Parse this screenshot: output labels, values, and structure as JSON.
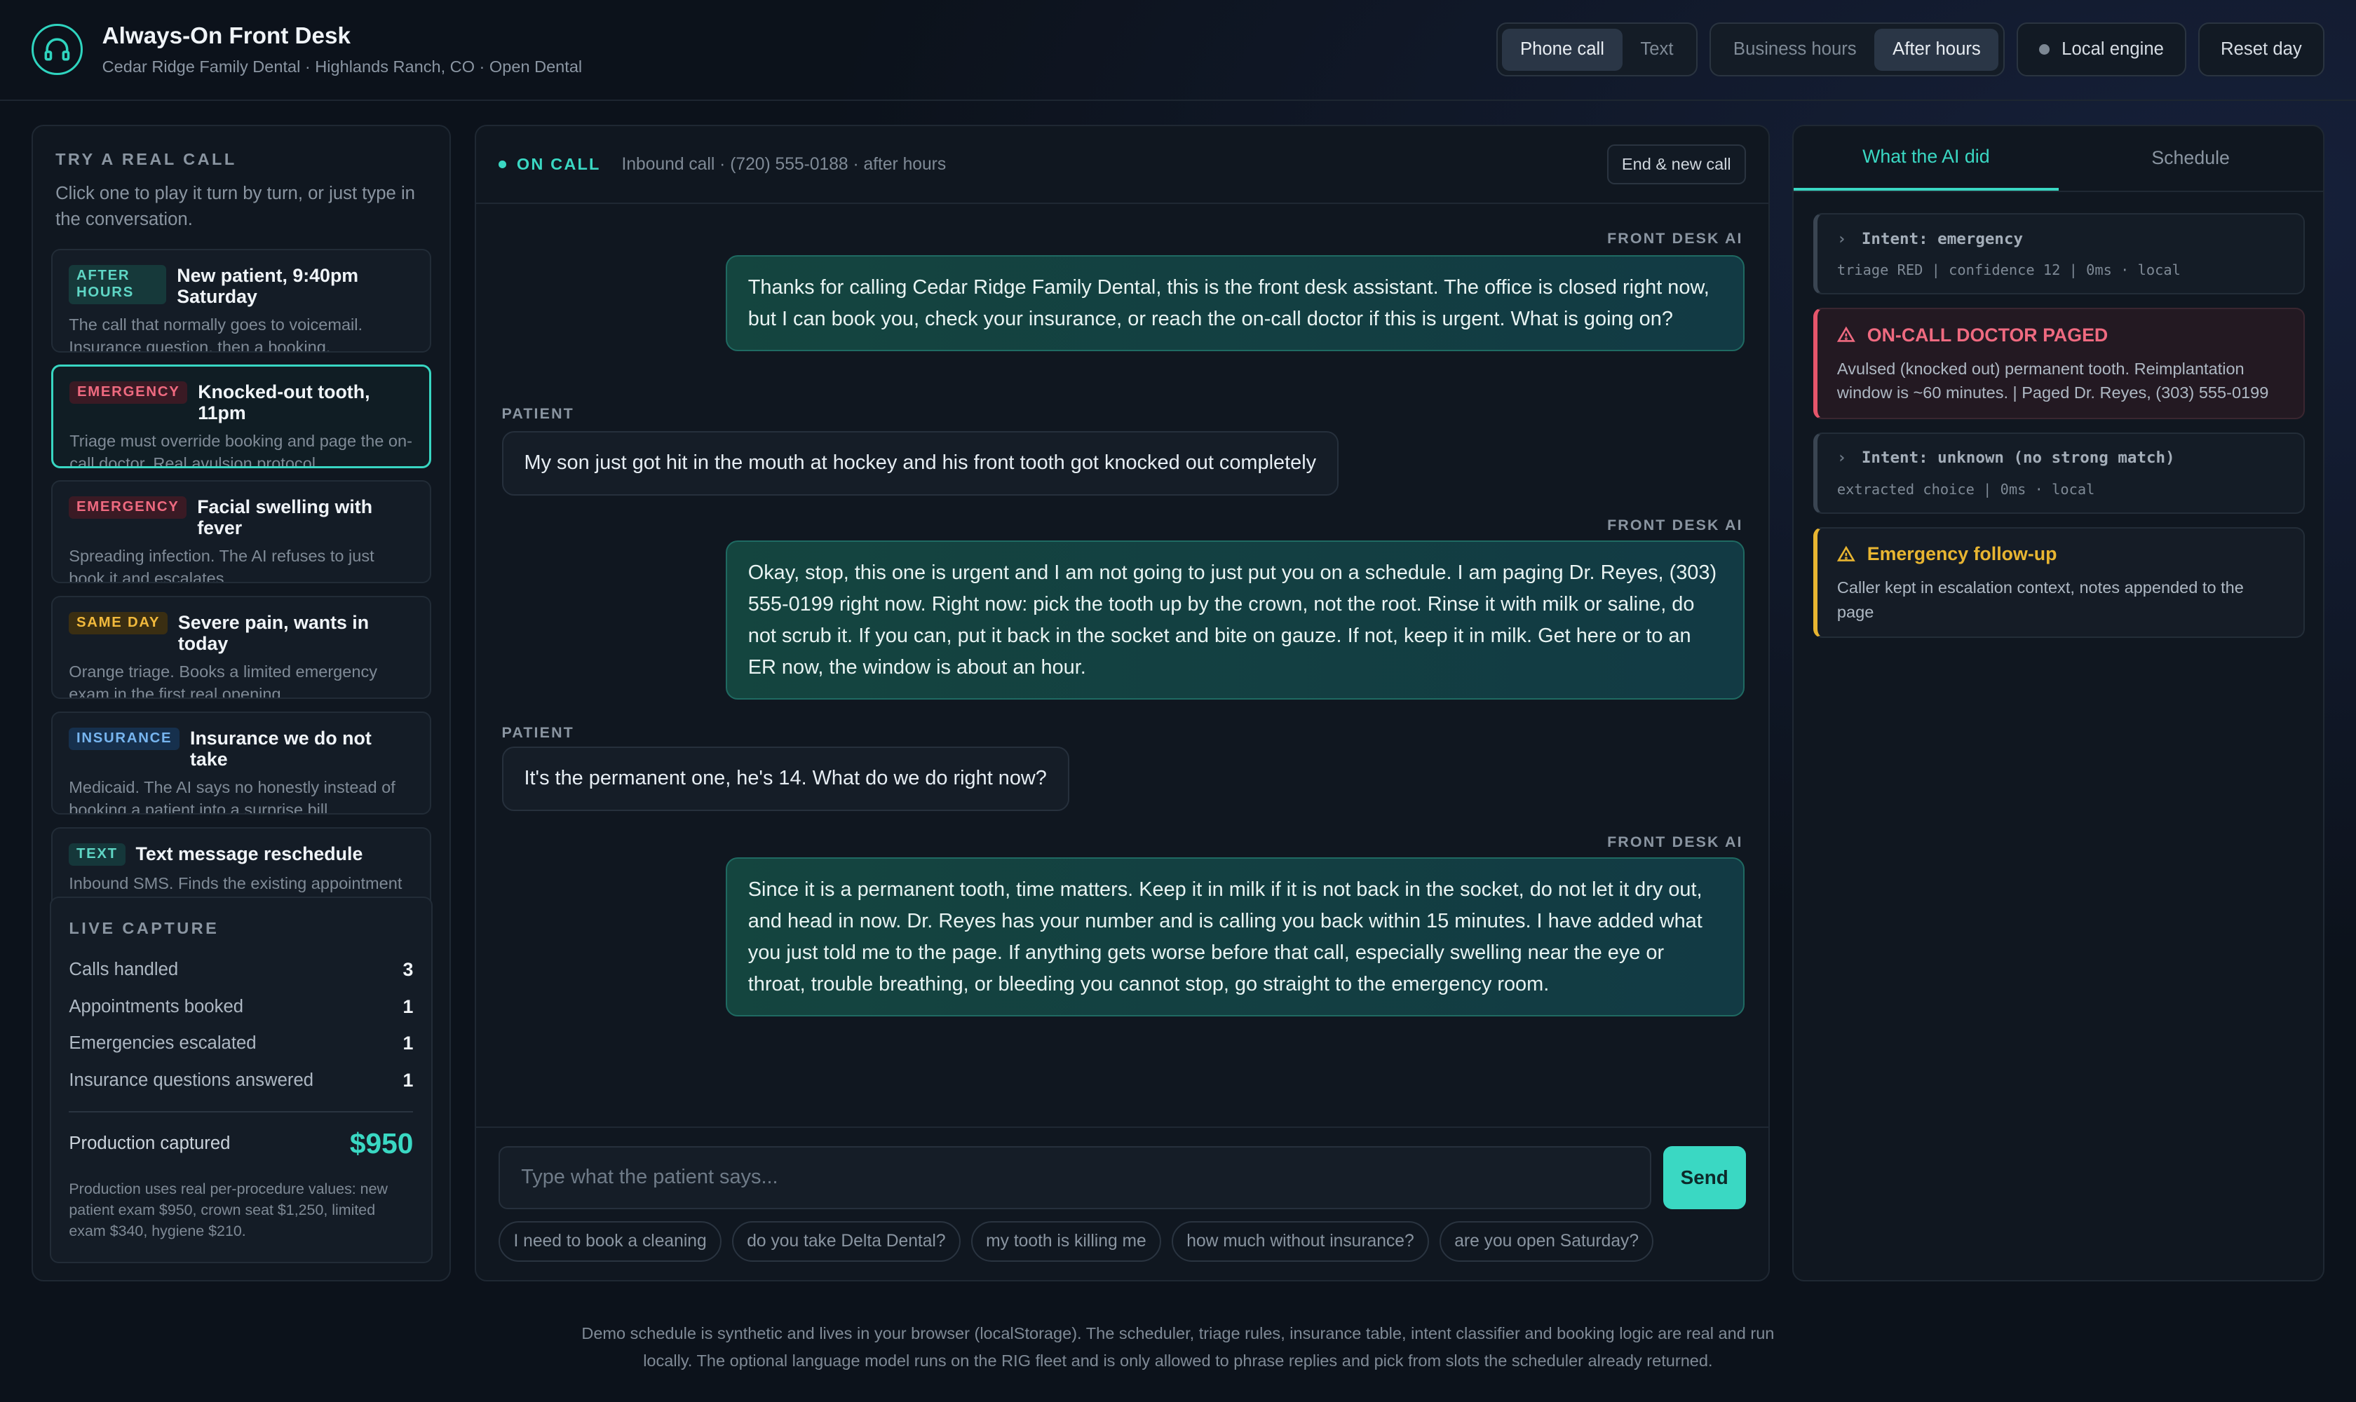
{
  "header": {
    "title": "Always-On Front Desk",
    "subtitle": "Cedar Ridge Family Dental · Highlands Ranch, CO · Open Dental",
    "channel": [
      "Phone call",
      "Text"
    ],
    "hours": [
      "Business hours",
      "After hours"
    ],
    "engine": "Local engine",
    "reset": "Reset day"
  },
  "left": {
    "title": "TRY A REAL CALL",
    "desc": "Click one to play it turn by turn, or just type in the conversation.",
    "scenarios": [
      {
        "badge": "AFTER HOURS",
        "title": "New patient, 9:40pm Saturday",
        "desc": "The call that normally goes to voicemail. Insurance question, then a booking."
      },
      {
        "badge": "EMERGENCY",
        "title": "Knocked-out tooth, 11pm",
        "desc": "Triage must override booking and page the on-call doctor. Real avulsion protocol."
      },
      {
        "badge": "EMERGENCY",
        "title": "Facial swelling with fever",
        "desc": "Spreading infection. The AI refuses to just book it and escalates."
      },
      {
        "badge": "SAME DAY",
        "title": "Severe pain, wants in today",
        "desc": "Orange triage. Books a limited emergency exam in the first real opening."
      },
      {
        "badge": "INSURANCE",
        "title": "Insurance we do not take",
        "desc": "Medicaid. The AI says no honestly instead of booking a patient into a surprise bill."
      },
      {
        "badge": "TEXT",
        "title": "Text message reschedule",
        "desc": "Inbound SMS. Finds the existing appointment and"
      }
    ],
    "capture": {
      "title": "LIVE CAPTURE",
      "rows": [
        {
          "label": "Calls handled",
          "value": "3"
        },
        {
          "label": "Appointments booked",
          "value": "1"
        },
        {
          "label": "Emergencies escalated",
          "value": "1"
        },
        {
          "label": "Insurance questions answered",
          "value": "1"
        }
      ],
      "production_label": "Production captured",
      "production_value": "$950",
      "note": "Production uses real per-procedure values: new patient exam $950, crown seat $1,250, limited exam $340, hygiene $210."
    }
  },
  "chat": {
    "status": "ON CALL",
    "info": "Inbound call · (720) 555-0188 · after hours",
    "end_button": "End & new call",
    "ai_label": "FRONT DESK AI",
    "patient_label": "PATIENT",
    "messages": [
      "Thanks for calling Cedar Ridge Family Dental, this is the front desk assistant. The office is closed right now, but I can book you, check your insurance, or reach the on-call doctor if this is urgent. What is going on?",
      "My son just got hit in the mouth at hockey and his front tooth got knocked out completely",
      "Okay, stop, this one is urgent and I am not going to just put you on a schedule. I am paging Dr. Reyes, (303) 555-0199 right now. Right now: pick the tooth up by the crown, not the root. Rinse it with milk or saline, do not scrub it. If you can, put it back in the socket and bite on gauze. If not, keep it in milk. Get here or to an ER now, the window is about an hour.",
      "It's the permanent one, he's 14. What do we do right now?",
      "Since it is a permanent tooth, time matters. Keep it in milk if it is not back in the socket, do not let it dry out, and head in now. Dr. Reyes has your number and is calling you back within 15 minutes. I have added what you just told me to the page. If anything gets worse before that call, especially swelling near the eye or throat, trouble breathing, or bleeding you cannot stop, go straight to the emergency room."
    ],
    "placeholder": "Type what the patient says...",
    "send": "Send",
    "chips": [
      "I need to book a cleaning",
      "do you take Delta Dental?",
      "my tooth is killing me",
      "how much without insurance?",
      "are you open Saturday?"
    ]
  },
  "right": {
    "tabs": [
      "What the AI did",
      "Schedule"
    ],
    "events": [
      {
        "title": "Intent: emergency",
        "sub": "triage RED | confidence 12 | 0ms · local"
      },
      {
        "title": "ON-CALL DOCTOR PAGED",
        "body": "Avulsed (knocked out) permanent tooth. Reimplantation window is ~60 minutes. | Paged Dr. Reyes, (303) 555-0199"
      },
      {
        "title": "Intent: unknown (no strong match)",
        "sub": "extracted choice | 0ms · local"
      },
      {
        "title": "Emergency follow-up",
        "body": "Caller kept in escalation context, notes appended to the page"
      }
    ]
  },
  "footer": "Demo schedule is synthetic and lives in your browser (localStorage). The scheduler, triage rules, insurance table, intent classifier and booking logic are real and run locally. The optional language model runs on the RIG fleet and is only allowed to phrase replies and pick from slots the scheduler already returned.",
  "colors": {
    "accent": "#3ad8c3",
    "danger": "#e5566b",
    "warning": "#e8b531"
  }
}
